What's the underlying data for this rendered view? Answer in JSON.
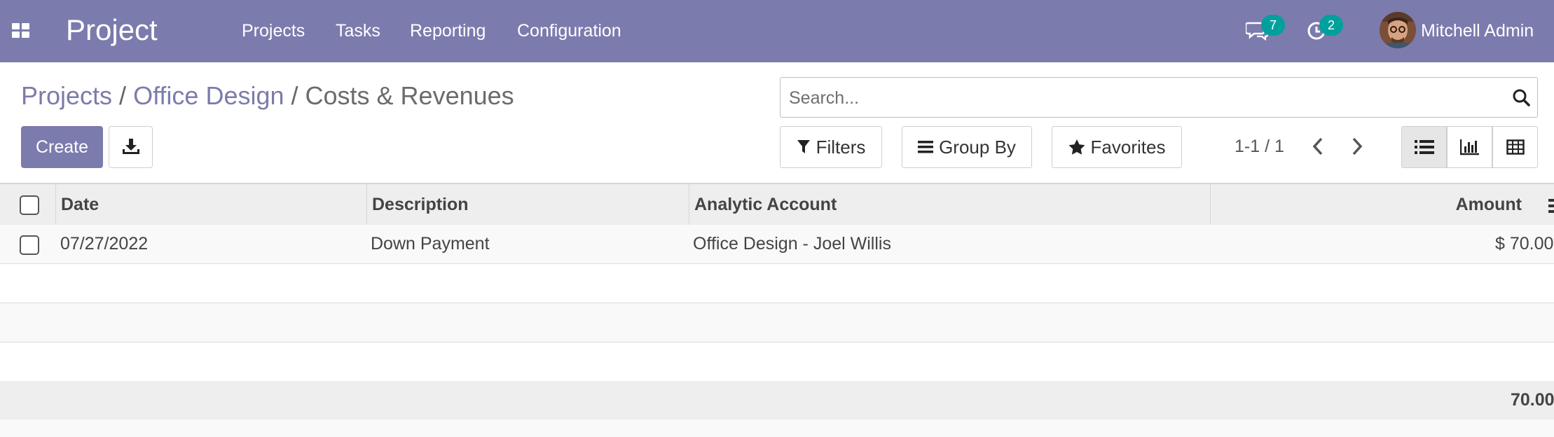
{
  "navbar": {
    "apps_icon": "grid-icon",
    "brand": "Project",
    "menu": [
      "Projects",
      "Tasks",
      "Reporting",
      "Configuration"
    ],
    "messages_badge": "7",
    "activities_badge": "2",
    "user_name": "Mitchell Admin",
    "bg_color": "#7c7bad",
    "badge_color": "#00a09d"
  },
  "breadcrumb": {
    "items": [
      "Projects",
      "Office Design"
    ],
    "separator": "/",
    "current": "Costs & Revenues"
  },
  "toolbar": {
    "create_label": "Create",
    "export_icon": "download-icon"
  },
  "search": {
    "placeholder": "Search...",
    "value": ""
  },
  "filters": {
    "filters_label": "Filters",
    "group_by_label": "Group By",
    "favorites_label": "Favorites"
  },
  "pager": {
    "value": "1-1 / 1"
  },
  "views": {
    "active": "list",
    "icons": [
      "list-icon",
      "graph-icon",
      "pivot-icon"
    ]
  },
  "table": {
    "columns": [
      "Date",
      "Description",
      "Analytic Account",
      "Amount"
    ],
    "rows": [
      {
        "date": "07/27/2022",
        "description": "Down Payment",
        "analytic_account": "Office Design - Joel Willis",
        "amount": "$ 70.00"
      }
    ],
    "total": "70.00"
  }
}
